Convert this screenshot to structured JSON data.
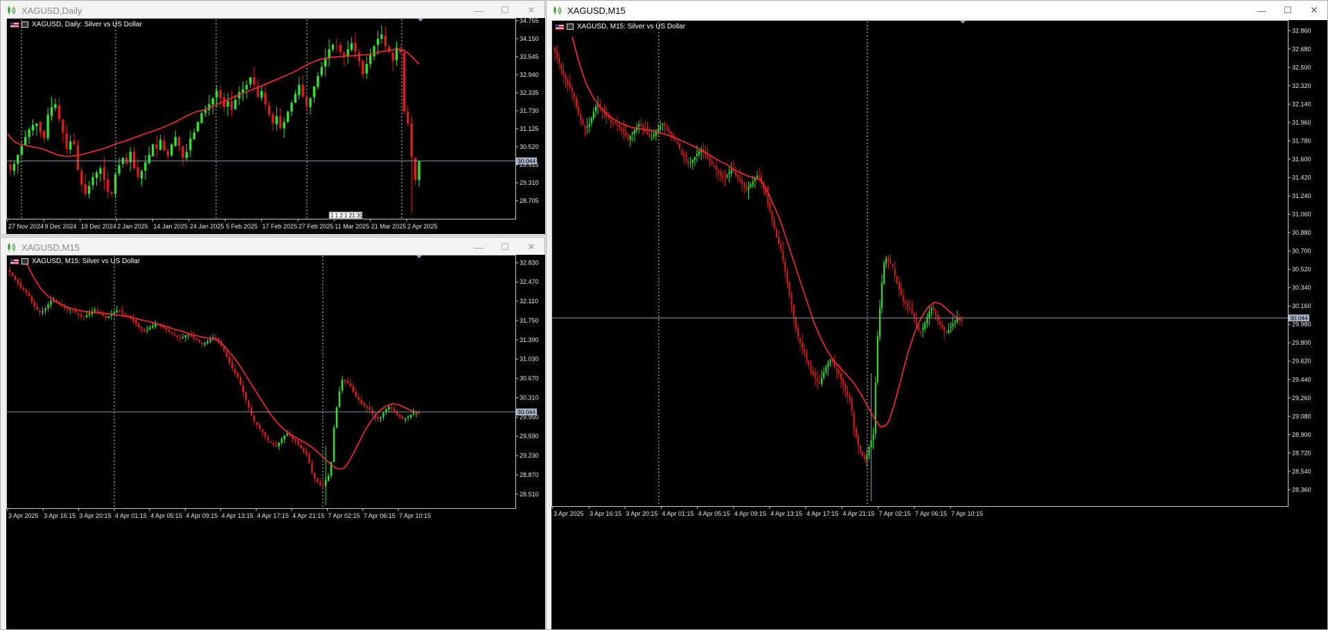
{
  "windows": {
    "daily": {
      "title": "XAGUSD,Daily",
      "header": "XAGUSD, Daily:  Silver vs US Dollar",
      "current_price": "30.044",
      "countdown": "1 1 2 1 21:30",
      "controls": {
        "minimize": "—",
        "maximize": "☐",
        "close": "✕"
      }
    },
    "m15_small": {
      "title": "XAGUSD,M15",
      "header": "XAGUSD, M15:  Silver vs US Dollar",
      "current_price": "30.044",
      "controls": {
        "minimize": "—",
        "maximize": "☐",
        "close": "✕"
      }
    },
    "m15_large": {
      "title": "XAGUSD,M15",
      "header": "XAGUSD, M15:  Silver vs US Dollar",
      "current_price": "30.044",
      "controls": {
        "minimize": "—",
        "maximize": "☐",
        "close": "✕"
      }
    }
  },
  "colors": {
    "bull": "#2ee62e",
    "bear": "#e11a1a",
    "ma": "#ff2a2a",
    "background": "#000000",
    "grid": "#d0d0d0"
  },
  "chart_data": [
    {
      "id": "daily",
      "type": "candlestick",
      "title": "XAGUSD, Daily:  Silver vs US Dollar",
      "y_ticks": [
        "34.755",
        "34.150",
        "33.545",
        "32.940",
        "32.335",
        "31.730",
        "31.125",
        "30.520",
        "29.915",
        "29.310",
        "28.705"
      ],
      "ylim": [
        28.1,
        34.8
      ],
      "x_ticks": [
        "27 Nov 2024",
        "9 Dec 2024",
        "19 Dec 2024",
        "2 Jan 2025",
        "14 Jan 2025",
        "24 Jan 2025",
        "5 Feb 2025",
        "17 Feb 2025",
        "27 Feb 2025",
        "11 Mar 2025",
        "21 Mar 2025",
        "2 Apr 2025"
      ],
      "closes": [
        29.75,
        29.95,
        30.25,
        30.55,
        30.85,
        31.1,
        31.25,
        31.3,
        31.0,
        30.8,
        31.6,
        31.85,
        31.95,
        31.45,
        31.0,
        30.45,
        30.7,
        30.6,
        29.75,
        29.25,
        28.95,
        29.2,
        29.5,
        29.65,
        29.8,
        29.4,
        29.0,
        28.95,
        29.6,
        29.9,
        30.15,
        29.95,
        30.35,
        29.8,
        29.5,
        29.7,
        30.0,
        30.25,
        30.6,
        30.45,
        30.75,
        30.4,
        30.2,
        30.6,
        30.85,
        30.55,
        30.15,
        30.35,
        30.8,
        31.0,
        31.35,
        31.65,
        31.75,
        31.95,
        32.15,
        32.4,
        32.15,
        31.85,
        32.05,
        31.75,
        32.1,
        32.35,
        32.45,
        32.6,
        32.85,
        32.6,
        32.2,
        32.4,
        31.95,
        31.6,
        31.3,
        31.55,
        31.15,
        31.35,
        31.7,
        32.0,
        32.3,
        32.6,
        32.2,
        31.9,
        32.15,
        32.55,
        32.9,
        33.2,
        33.5,
        33.8,
        33.95,
        33.9,
        33.7,
        33.55,
        33.8,
        34.0,
        33.7,
        33.4,
        32.95,
        33.3,
        33.6,
        33.9,
        34.15,
        34.3,
        33.9,
        33.7,
        33.4,
        33.85,
        33.7,
        31.7,
        31.3,
        30.2,
        29.4,
        30.05
      ],
      "ma_closes": [
        30.95,
        30.78,
        30.66,
        30.6,
        30.58,
        30.55,
        30.52,
        30.49,
        30.47,
        30.42,
        30.36,
        30.3,
        30.25,
        30.22,
        30.2,
        30.2,
        30.22,
        30.24,
        30.26,
        30.3,
        30.34,
        30.38,
        30.42,
        30.46,
        30.5,
        30.56,
        30.62,
        30.66,
        30.7,
        30.75,
        30.8,
        30.85,
        30.9,
        30.96,
        31.0,
        31.05,
        31.1,
        31.15,
        31.21,
        31.27,
        31.33,
        31.4,
        31.48,
        31.55,
        31.62,
        31.68,
        31.72,
        31.75,
        31.8,
        31.86,
        31.92,
        31.98,
        32.04,
        32.1,
        32.16,
        32.22,
        32.28,
        32.34,
        32.4,
        32.45,
        32.5,
        32.56,
        32.62,
        32.68,
        32.74,
        32.8,
        32.86,
        32.92,
        32.98,
        33.04,
        33.12,
        33.2,
        33.28,
        33.34,
        33.4,
        33.45,
        33.48,
        33.5,
        33.53,
        33.54,
        33.55,
        33.56,
        33.57,
        33.58,
        33.59,
        33.6,
        33.61,
        33.62,
        33.65,
        33.69,
        33.72,
        33.74,
        33.77,
        33.79,
        33.8,
        33.78,
        33.7,
        33.58,
        33.44,
        33.3
      ],
      "current_price": 30.044
    },
    {
      "id": "m15_small",
      "type": "candlestick",
      "title": "XAGUSD, M15:  Silver vs US Dollar",
      "y_ticks": [
        "32.830",
        "32.470",
        "32.110",
        "31.750",
        "31.390",
        "31.030",
        "30.670",
        "30.310",
        "29.950",
        "29.590",
        "29.230",
        "28.870",
        "28.510"
      ],
      "ylim": [
        28.25,
        32.95
      ],
      "x_ticks": [
        "3 Apr 2025",
        "3 Apr 16:15",
        "3 Apr 20:15",
        "4 Apr 01:15",
        "4 Apr 05:15",
        "4 Apr 09:15",
        "4 Apr 13:15",
        "4 Apr 17:15",
        "4 Apr 21:15",
        "7 Apr 02:15",
        "7 Apr 06:15",
        "7 Apr 10:15"
      ],
      "closes": [
        32.65,
        32.55,
        32.45,
        32.35,
        32.3,
        32.2,
        32.05,
        31.95,
        31.9,
        31.95,
        32.05,
        32.15,
        32.1,
        32.05,
        32.0,
        31.95,
        31.95,
        31.9,
        31.85,
        31.8,
        31.85,
        31.9,
        31.95,
        31.9,
        31.85,
        31.8,
        31.85,
        31.9,
        31.95,
        31.9,
        31.85,
        31.8,
        31.75,
        31.65,
        31.6,
        31.55,
        31.6,
        31.65,
        31.7,
        31.65,
        31.6,
        31.55,
        31.5,
        31.45,
        31.4,
        31.45,
        31.5,
        31.45,
        31.4,
        31.35,
        31.3,
        31.35,
        31.4,
        31.45,
        31.35,
        31.25,
        31.1,
        30.95,
        30.8,
        30.7,
        30.5,
        30.3,
        30.1,
        29.9,
        29.8,
        29.7,
        29.6,
        29.5,
        29.45,
        29.4,
        29.5,
        29.6,
        29.65,
        29.55,
        29.5,
        29.4,
        29.3,
        29.25,
        28.95,
        28.8,
        28.7,
        28.65,
        28.8,
        28.9,
        29.8,
        30.3,
        30.65,
        30.6,
        30.55,
        30.4,
        30.3,
        30.2,
        30.15,
        30.1,
        30.0,
        29.9,
        29.95,
        30.05,
        30.15,
        30.1,
        30.0,
        29.95,
        29.9,
        29.95,
        30.0,
        30.05,
        30.04
      ],
      "ma_closes": [
        32.8,
        32.55,
        32.35,
        32.22,
        32.12,
        32.05,
        32.0,
        31.96,
        31.93,
        31.91,
        31.9,
        31.89,
        31.88,
        31.86,
        31.84,
        31.82,
        31.79,
        31.76,
        31.73,
        31.7,
        31.66,
        31.62,
        31.58,
        31.55,
        31.5,
        31.47,
        31.44,
        31.42,
        31.4,
        31.3,
        31.15,
        31.0,
        30.8,
        30.6,
        30.4,
        30.2,
        30.0,
        29.85,
        29.72,
        29.62,
        29.55,
        29.48,
        29.4,
        29.3,
        29.18,
        29.06,
        28.97,
        29.0,
        29.2,
        29.45,
        29.7,
        29.9,
        30.05,
        30.15,
        30.2,
        30.18,
        30.12,
        30.06,
        30.02
      ],
      "current_price": 30.044
    },
    {
      "id": "m15_large",
      "type": "candlestick",
      "title": "XAGUSD, M15:  Silver vs US Dollar",
      "y_ticks": [
        "32.860",
        "32.680",
        "32.500",
        "32.320",
        "32.140",
        "31.960",
        "31.780",
        "31.600",
        "31.420",
        "31.240",
        "31.060",
        "30.880",
        "30.700",
        "30.520",
        "30.340",
        "30.160",
        "29.980",
        "29.800",
        "29.620",
        "29.440",
        "29.260",
        "29.080",
        "28.900",
        "28.720",
        "28.540",
        "28.360"
      ],
      "ylim": [
        28.2,
        32.95
      ],
      "x_ticks": [
        "3 Apr 2025",
        "3 Apr 16:15",
        "3 Apr 20:15",
        "4 Apr 01:15",
        "4 Apr 05:15",
        "4 Apr 09:15",
        "4 Apr 13:15",
        "4 Apr 17:15",
        "4 Apr 21:15",
        "7 Apr 02:15",
        "7 Apr 06:15",
        "7 Apr 10:15"
      ],
      "current_price": 30.044
    }
  ]
}
